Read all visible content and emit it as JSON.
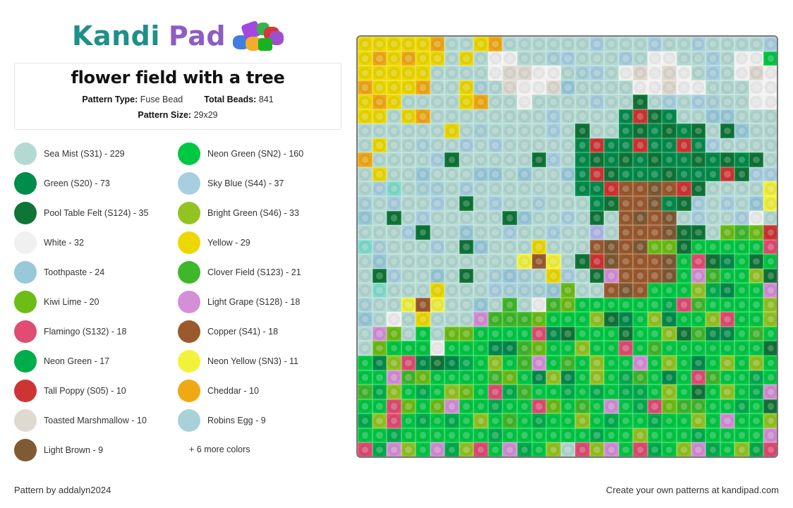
{
  "brand": {
    "name_part1": "Kandi",
    "name_part2": "Pad"
  },
  "pattern": {
    "title": "flower field with a tree",
    "type_label": "Pattern Type:",
    "type_value": "Fuse Bead",
    "beads_label": "Total Beads:",
    "beads_value": "841",
    "size_label": "Pattern Size:",
    "size_value": "29x29"
  },
  "legend": {
    "items": [
      {
        "label": "Sea Mist (S31) - 229",
        "color": "#b3d9d2"
      },
      {
        "label": "Neon Green (SN2) - 160",
        "color": "#00c843"
      },
      {
        "label": "Green (S20) - 73",
        "color": "#008c4a"
      },
      {
        "label": "Sky Blue (S44) - 37",
        "color": "#a8cfe0"
      },
      {
        "label": "Pool Table Felt (S124) - 35",
        "color": "#0e7536"
      },
      {
        "label": "Bright Green (S46) - 33",
        "color": "#93c322"
      },
      {
        "label": "White - 32",
        "color": "#f0f0f0"
      },
      {
        "label": "Yellow - 29",
        "color": "#ecd800"
      },
      {
        "label": "Toothpaste - 24",
        "color": "#98c9d8"
      },
      {
        "label": "Clover Field (S123) - 21",
        "color": "#3eb82a"
      },
      {
        "label": "Kiwi Lime - 20",
        "color": "#6cbd15"
      },
      {
        "label": "Light Grape (S128) - 18",
        "color": "#d48fd6"
      },
      {
        "label": "Flamingo (S132) - 18",
        "color": "#e04c72"
      },
      {
        "label": "Copper (S41) - 18",
        "color": "#9b5a2e"
      },
      {
        "label": "Neon Green - 17",
        "color": "#00ad4b"
      },
      {
        "label": "Neon Yellow (SN3) - 11",
        "color": "#f2f23a"
      },
      {
        "label": "Tall Poppy (S05) - 10",
        "color": "#cf3434"
      },
      {
        "label": "Cheddar - 10",
        "color": "#f0a913"
      },
      {
        "label": "Toasted Marshmallow - 10",
        "color": "#dfdad0"
      },
      {
        "label": "Robins Egg - 9",
        "color": "#a9d1d9"
      },
      {
        "label": "Light Brown - 9",
        "color": "#7f5a33"
      }
    ],
    "more_label": "+ 6 more colors"
  },
  "palette": {
    "s": "#b3d9d2",
    "k": "#a8cfe0",
    "p": "#98c9d8",
    "r": "#a9d1d9",
    "y": "#ecd800",
    "o": "#f0a913",
    "w": "#f0f0f0",
    "t": "#dfdad0",
    "g": "#008c4a",
    "d": "#0e7536",
    "x": "#cf3434",
    "c": "#9b5a2e",
    "b": "#7f5a33",
    "n": "#00c843",
    "m": "#00ad4b",
    "e": "#3eb82a",
    "i": "#6cbd15",
    "h": "#93c322",
    "f": "#e04c72",
    "l": "#d48fd6",
    "v": "#f2f23a",
    "q": "#82dccc",
    "u": "#b0b8e8"
  },
  "grid": [
    "yyyyyossyossssssksssksskssssk",
    "yoyoyysyswwssrkssskswwssksww",
    "yyyyysssswttwwsrkswtwtwskswtw",
    "oyyyossyrstwwtpsssswwtwwssswwt",
    "yoyssssyosswsssskssdskskrsswwt",
    "yysyosssssssskssssgxdgssppsss",
    "ssssssysrssssksdssgdgdgdsdpssk",
    "syssrssksksssssgxggxggxgkssssk",
    "osssskdsssssdksgdgdgdggdgdgdsk",
    "sysspsssppspsspgxdgggdgggxdkkv",
    "skqsrrsksssssssggxccbcxdssssvc",
    "rskssksdskssrsssgdccbgdkskspv",
    "psdsksssssdpssksdscbcbsksskwsn",
    "ssskdsspssksskssuscccbddsieixii",
    "qrsssksdpsssyssscbcbiidnnnnnf",
    "spsssssssssvcvsdxbcccbnfdgndn",
    "sdksspsdsrprsyksdlcccbnlennhdnn",
    "sqsssyssskrrrpisscbcnnnhmgnnlg",
    "rssvcvsspsesweinnnnnnmfennnnhn",
    "pswsysssleeeinnnhdgnhgnnhfnnh",
    "slisnsiinnnnfgdnnndnnhdeggnen",
    "sinnnwnnnggeinnhnnfnennnnnnnd",
    "nghfgdgmnhnelnenhnnlnhngnhnhn",
    "nnleinnnneinghgnhnmengnfennmn",
    "emhnmnhinfmennmnmnmmnhndnhnmln",
    "nnfinilnnmnnfinenlnmfieennmnd",
    "mhfnmnmnhnenmnnhnmnnmnnhnlnnh",
    "nnmnnnnnnmnnnnnnmnnhnnnmnnnnl",
    "fmlhnlmhfnlmnhsfhlnfmnhlmnhmf"
  ],
  "footer": {
    "credit": "Pattern by addalyn2024",
    "promo": "Create your own patterns at kandipad.com"
  }
}
